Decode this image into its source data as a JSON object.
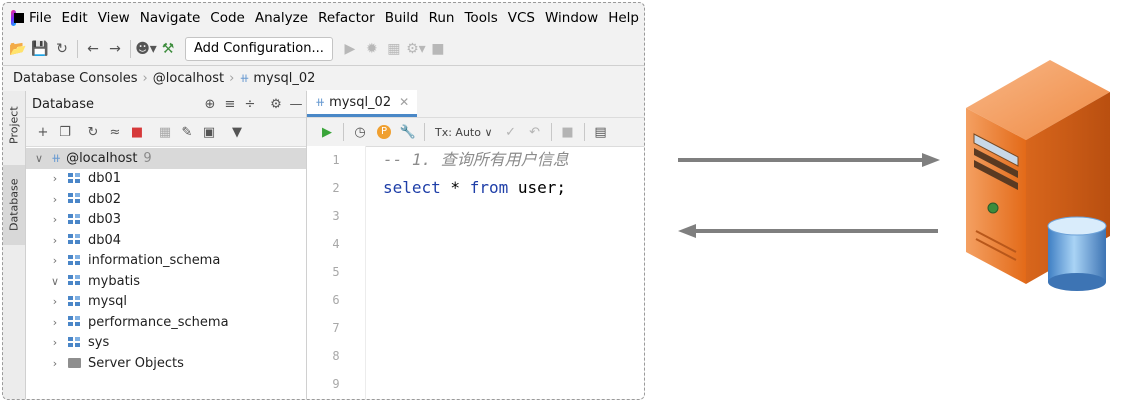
{
  "menu": [
    "File",
    "Edit",
    "View",
    "Navigate",
    "Code",
    "Analyze",
    "Refactor",
    "Build",
    "Run",
    "Tools",
    "VCS",
    "Window",
    "Help"
  ],
  "toolbar": {
    "add_config": "Add Configuration..."
  },
  "breadcrumb": {
    "root": "Database Consoles",
    "host": "@localhost",
    "console": "mysql_02"
  },
  "side_tabs": {
    "project": "Project",
    "database": "Database"
  },
  "db_panel": {
    "title": "Database",
    "root": {
      "name": "@localhost",
      "count": "9"
    },
    "items": [
      {
        "name": "db01",
        "expanded": false,
        "type": "schema"
      },
      {
        "name": "db02",
        "expanded": false,
        "type": "schema"
      },
      {
        "name": "db03",
        "expanded": false,
        "type": "schema"
      },
      {
        "name": "db04",
        "expanded": false,
        "type": "schema"
      },
      {
        "name": "information_schema",
        "expanded": false,
        "type": "schema"
      },
      {
        "name": "mybatis",
        "expanded": true,
        "type": "schema"
      },
      {
        "name": "mysql",
        "expanded": false,
        "type": "schema"
      },
      {
        "name": "performance_schema",
        "expanded": false,
        "type": "schema"
      },
      {
        "name": "sys",
        "expanded": false,
        "type": "schema"
      },
      {
        "name": "Server Objects",
        "expanded": false,
        "type": "folder"
      }
    ]
  },
  "editor": {
    "tab": "mysql_02",
    "tx_mode": "Tx: Auto",
    "line_numbers": [
      "1",
      "2",
      "3",
      "4",
      "5",
      "6",
      "7",
      "8",
      "9"
    ],
    "code": {
      "comment": "-- 1. 查询所有用户信息",
      "kw_select": "select",
      "star": " * ",
      "kw_from": "from",
      "rest": " user;"
    }
  },
  "colors": {
    "arrow": "#7f7f7f",
    "server_orange": "#e8782a",
    "db_blue": "#4f8fd0"
  },
  "icons": [
    "app-logo-icon",
    "open-folder-icon",
    "save-icon",
    "sync-icon",
    "back-arrow-icon",
    "forward-arrow-icon",
    "user-icon",
    "build-hammer-icon",
    "run-icon",
    "debug-icon",
    "coverage-icon",
    "profile-icon",
    "stop-icon",
    "locate-icon",
    "expand-icon",
    "collapse-icon",
    "gear-icon",
    "minimize-icon",
    "add-icon",
    "copy-icon",
    "refresh-icon",
    "schema-icon",
    "stop-square-icon",
    "table-icon",
    "edit-icon",
    "console-icon",
    "filter-icon",
    "execute-icon",
    "history-icon",
    "parameter-icon",
    "settings-wrench-icon",
    "commit-icon",
    "rollback-icon",
    "cancel-icon",
    "results-icon"
  ]
}
